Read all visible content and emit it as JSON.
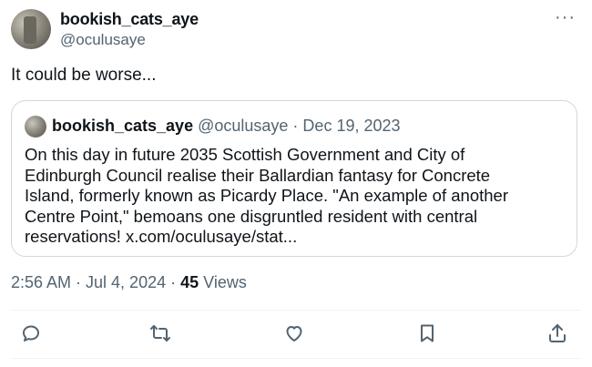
{
  "author": {
    "display_name": "bookish_cats_aye",
    "handle": "@oculusaye"
  },
  "more_icon": "more-horizontal-icon",
  "tweet": {
    "text": "It could be worse..."
  },
  "quote": {
    "display_name": "bookish_cats_aye",
    "meta": "@oculusaye · Dec 19, 2023",
    "lines": [
      "On this day in future 2035 Scottish Government and City of",
      "Edinburgh Council realise their Ballardian fantasy for Concrete",
      "Island, formerly known as Picardy Place. \"An example of another",
      "Centre Point,\" bemoans one disgruntled resident with central",
      "reservations! x.com/oculusaye/stat..."
    ]
  },
  "meta": {
    "time_date": "2:56 AM · Jul 4, 2024 · ",
    "views_count": "45",
    "views_label": " Views"
  },
  "actions": [
    {
      "name": "reply",
      "icon": "reply-icon"
    },
    {
      "name": "retweet",
      "icon": "retweet-icon"
    },
    {
      "name": "like",
      "icon": "heart-icon"
    },
    {
      "name": "bookmark",
      "icon": "bookmark-icon"
    },
    {
      "name": "share",
      "icon": "share-icon"
    }
  ],
  "colors": {
    "text": "#0f1419",
    "secondary": "#536471",
    "border": "#cfd9de"
  }
}
